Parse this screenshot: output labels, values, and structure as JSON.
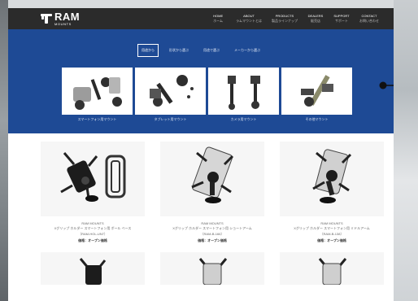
{
  "header": {
    "logo_name": "RAM",
    "logo_sub": "MOUNTS",
    "nav": [
      {
        "label": "HOME",
        "sub": "ホーム"
      },
      {
        "label": "ABOUT",
        "sub": "ラムマウントとは"
      },
      {
        "label": "PRODUCTS",
        "sub": "製品ラインナップ"
      },
      {
        "label": "DEALERS",
        "sub": "販売店"
      },
      {
        "label": "SUPPORT",
        "sub": "サポート"
      },
      {
        "label": "CONTACT",
        "sub": "お問い合わせ"
      }
    ]
  },
  "hero": {
    "tabs": [
      "用途から",
      "形状から選ぶ",
      "用途で選ぶ",
      "メーカーから選ぶ"
    ],
    "categories": [
      {
        "label": "スマートフォン用マウント",
        "icon": "phone-mount-icon"
      },
      {
        "label": "タブレット用マウント",
        "icon": "tablet-mount-icon"
      },
      {
        "label": "カメラ用マウント",
        "icon": "camera-mount-icon"
      },
      {
        "label": "その他マウント",
        "icon": "other-mount-icon"
      }
    ]
  },
  "products": [
    {
      "line1": "RAM MOUNTS",
      "line2": "Xグリップ ホルダー スマートフォン用 ボール ベース",
      "line3": "（RAM-HOL-UN7）",
      "price": "価格：オープン価格"
    },
    {
      "line1": "RAM MOUNTS",
      "line2": "Xグリップ ホルダー スマートフォン用 ショートアーム",
      "line3": "（RAM-B-166）",
      "price": "価格：オープン価格"
    },
    {
      "line1": "RAM MOUNTS",
      "line2": "Xグリップ ホルダー スマートフォン用 ミドルアーム",
      "line3": "（RAM-B-138）",
      "price": "価格：オープン価格"
    }
  ],
  "colors": {
    "topbar": "#2b2b2b",
    "hero": "#1e4a95",
    "accent": "#ffffff"
  }
}
